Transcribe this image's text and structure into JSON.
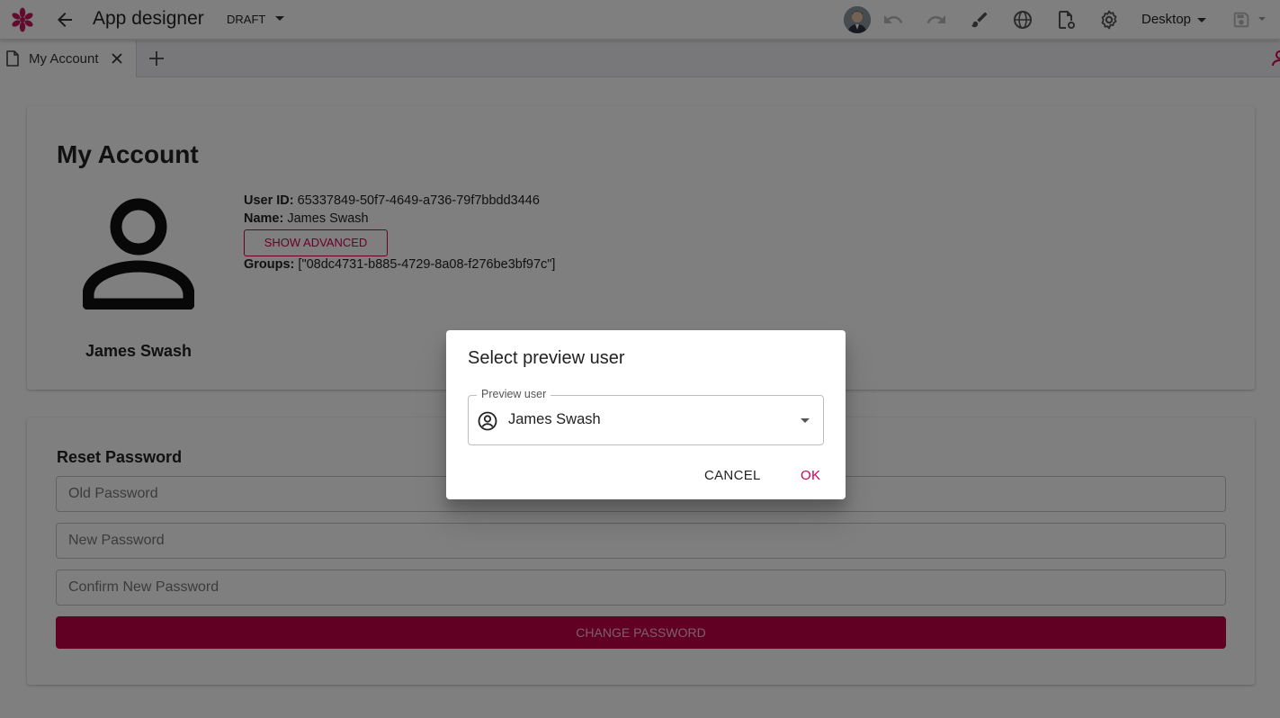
{
  "app": {
    "title": "App designer",
    "status": "DRAFT",
    "device": "Desktop"
  },
  "toolbar": {
    "icons": [
      "undo-icon",
      "redo-icon",
      "brush-icon",
      "globe-icon",
      "page-settings-icon",
      "gear-icon",
      "save-icon"
    ]
  },
  "tabs": [
    {
      "label": "My Account",
      "active": true
    }
  ],
  "account": {
    "title": "My Account",
    "display_name": "James Swash",
    "user_id_label": "User ID:",
    "user_id": "65337849-50f7-4649-a736-79f7bbdd3446",
    "name_label": "Name:",
    "name": "James Swash",
    "show_advanced_label": "SHOW ADVANCED",
    "groups_label": "Groups:",
    "groups": "[\"08dc4731-b885-4729-8a08-f276be3bf97c\"]"
  },
  "reset_password": {
    "title": "Reset Password",
    "old_placeholder": "Old Password",
    "new_placeholder": "New Password",
    "confirm_placeholder": "Confirm New Password",
    "submit_label": "CHANGE PASSWORD"
  },
  "dialog": {
    "title": "Select preview user",
    "field_label": "Preview user",
    "selected_user": "James Swash",
    "cancel_label": "CANCEL",
    "ok_label": "OK"
  },
  "colors": {
    "accent": "#d4004f",
    "button_fill": "#c20046",
    "overlay": "rgba(0,0,0,0.5)"
  }
}
